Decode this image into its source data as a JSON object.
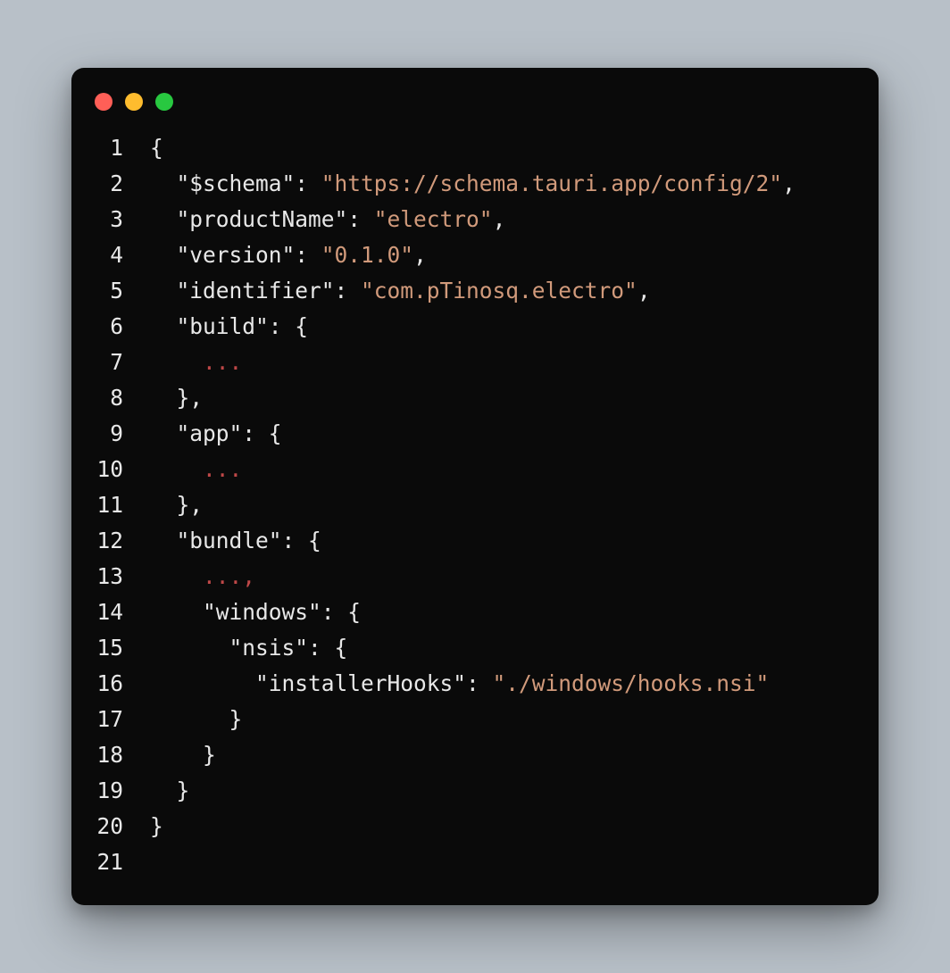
{
  "window": {
    "traffic_lights": [
      "close",
      "minimize",
      "zoom"
    ]
  },
  "colors": {
    "background_page": "#b8c0c8",
    "window_bg": "#0a0a0a",
    "text": "#e8e8e8",
    "string": "#d19a7b",
    "fold": "#c04848",
    "dot_red": "#ff5f57",
    "dot_yellow": "#febc2e",
    "dot_green": "#28c840"
  },
  "code": {
    "language": "json",
    "lines": [
      {
        "n": "1",
        "tokens": [
          {
            "t": "{",
            "c": "punc"
          }
        ]
      },
      {
        "n": "2",
        "tokens": [
          {
            "t": "  ",
            "c": "punc"
          },
          {
            "t": "\"$schema\"",
            "c": "key"
          },
          {
            "t": ": ",
            "c": "punc"
          },
          {
            "t": "\"https://schema.tauri.app/config/2\"",
            "c": "string"
          },
          {
            "t": ",",
            "c": "punc"
          }
        ]
      },
      {
        "n": "3",
        "tokens": [
          {
            "t": "  ",
            "c": "punc"
          },
          {
            "t": "\"productName\"",
            "c": "key"
          },
          {
            "t": ": ",
            "c": "punc"
          },
          {
            "t": "\"electro\"",
            "c": "string"
          },
          {
            "t": ",",
            "c": "punc"
          }
        ]
      },
      {
        "n": "4",
        "tokens": [
          {
            "t": "  ",
            "c": "punc"
          },
          {
            "t": "\"version\"",
            "c": "key"
          },
          {
            "t": ": ",
            "c": "punc"
          },
          {
            "t": "\"0.1.0\"",
            "c": "string"
          },
          {
            "t": ",",
            "c": "punc"
          }
        ]
      },
      {
        "n": "5",
        "tokens": [
          {
            "t": "  ",
            "c": "punc"
          },
          {
            "t": "\"identifier\"",
            "c": "key"
          },
          {
            "t": ": ",
            "c": "punc"
          },
          {
            "t": "\"com.pTinosq.electro\"",
            "c": "string"
          },
          {
            "t": ",",
            "c": "punc"
          }
        ]
      },
      {
        "n": "6",
        "tokens": [
          {
            "t": "  ",
            "c": "punc"
          },
          {
            "t": "\"build\"",
            "c": "key"
          },
          {
            "t": ": {",
            "c": "punc"
          }
        ]
      },
      {
        "n": "7",
        "tokens": [
          {
            "t": "    ",
            "c": "punc"
          },
          {
            "t": "...",
            "c": "fold"
          }
        ]
      },
      {
        "n": "8",
        "tokens": [
          {
            "t": "  },",
            "c": "punc"
          }
        ]
      },
      {
        "n": "9",
        "tokens": [
          {
            "t": "  ",
            "c": "punc"
          },
          {
            "t": "\"app\"",
            "c": "key"
          },
          {
            "t": ": {",
            "c": "punc"
          }
        ]
      },
      {
        "n": "10",
        "tokens": [
          {
            "t": "    ",
            "c": "punc"
          },
          {
            "t": "...",
            "c": "fold"
          }
        ]
      },
      {
        "n": "11",
        "tokens": [
          {
            "t": "  },",
            "c": "punc"
          }
        ]
      },
      {
        "n": "12",
        "tokens": [
          {
            "t": "  ",
            "c": "punc"
          },
          {
            "t": "\"bundle\"",
            "c": "key"
          },
          {
            "t": ": {",
            "c": "punc"
          }
        ]
      },
      {
        "n": "13",
        "tokens": [
          {
            "t": "    ",
            "c": "punc"
          },
          {
            "t": "...,",
            "c": "fold"
          }
        ]
      },
      {
        "n": "14",
        "tokens": [
          {
            "t": "    ",
            "c": "punc"
          },
          {
            "t": "\"windows\"",
            "c": "key"
          },
          {
            "t": ": {",
            "c": "punc"
          }
        ]
      },
      {
        "n": "15",
        "tokens": [
          {
            "t": "      ",
            "c": "punc"
          },
          {
            "t": "\"nsis\"",
            "c": "key"
          },
          {
            "t": ": {",
            "c": "punc"
          }
        ]
      },
      {
        "n": "16",
        "tokens": [
          {
            "t": "        ",
            "c": "punc"
          },
          {
            "t": "\"installerHooks\"",
            "c": "key"
          },
          {
            "t": ": ",
            "c": "punc"
          },
          {
            "t": "\"./windows/hooks.nsi\"",
            "c": "string"
          }
        ]
      },
      {
        "n": "17",
        "tokens": [
          {
            "t": "      }",
            "c": "punc"
          }
        ]
      },
      {
        "n": "18",
        "tokens": [
          {
            "t": "    }",
            "c": "punc"
          }
        ]
      },
      {
        "n": "19",
        "tokens": [
          {
            "t": "  }",
            "c": "punc"
          }
        ]
      },
      {
        "n": "20",
        "tokens": [
          {
            "t": "}",
            "c": "punc"
          }
        ]
      },
      {
        "n": "21",
        "tokens": [
          {
            "t": "",
            "c": "punc"
          }
        ]
      }
    ]
  }
}
